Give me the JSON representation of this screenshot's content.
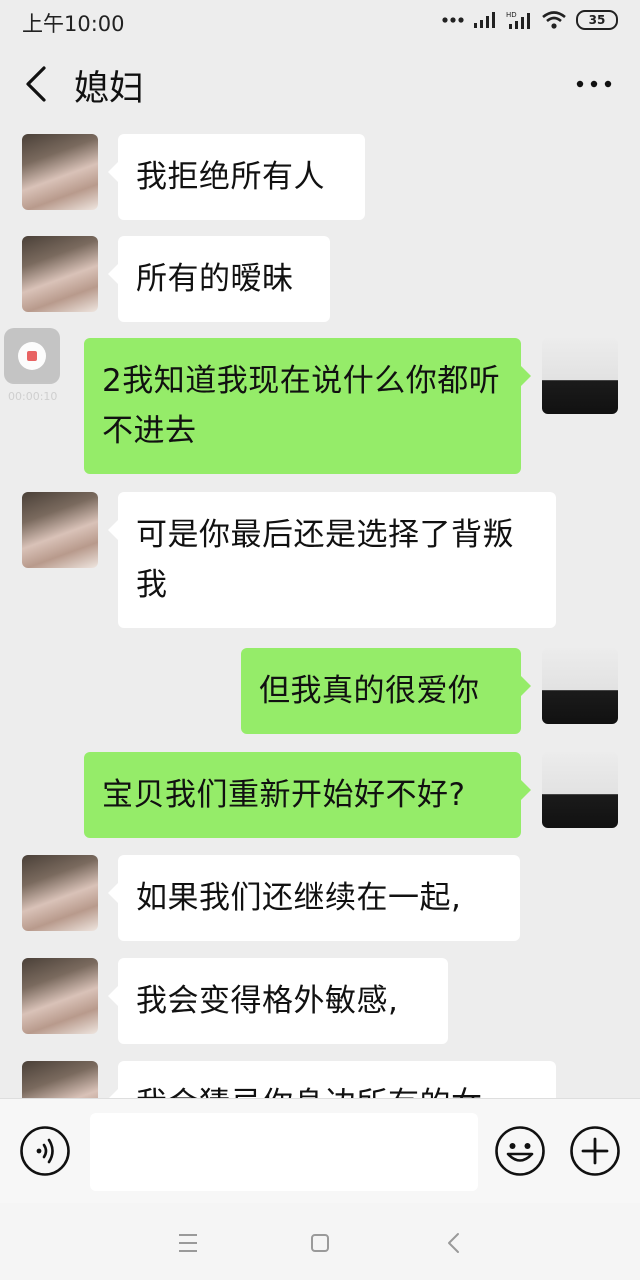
{
  "status_bar": {
    "time": "上午10:00",
    "battery": "35"
  },
  "header": {
    "title": "媳妇"
  },
  "recorder": {
    "time": "00:00:10"
  },
  "messages": [
    {
      "side": "in",
      "text": "我拒绝所有人"
    },
    {
      "side": "in",
      "text": "所有的暧昧"
    },
    {
      "side": "out",
      "text": "2我知道我现在说什么你都听不进去"
    },
    {
      "side": "in",
      "text": "可是你最后还是选择了背叛我"
    },
    {
      "side": "out",
      "text": "但我真的很爱你"
    },
    {
      "side": "out",
      "text": "宝贝我们重新开始好不好?"
    },
    {
      "side": "in",
      "text": "如果我们还继续在一起,"
    },
    {
      "side": "in",
      "text": "我会变得格外敏感,"
    },
    {
      "side": "in",
      "text": "我会猜忌你身边所有的女"
    }
  ],
  "icons": {
    "back": "chevron-left-icon",
    "more": "more-dots-icon",
    "voice": "voice-icon",
    "emoji": "emoji-icon",
    "add": "plus-icon"
  },
  "colors": {
    "incoming_bubble": "#ffffff",
    "outgoing_bubble": "#95ec69",
    "background": "#ededed"
  }
}
